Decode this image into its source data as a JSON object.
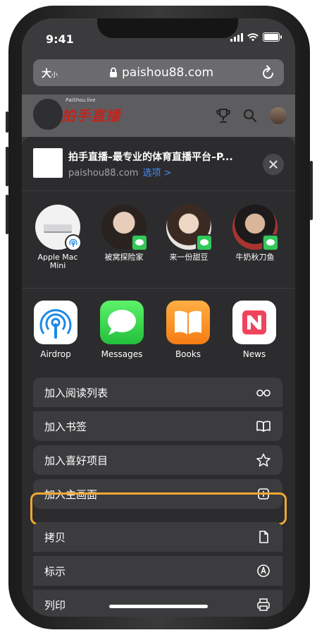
{
  "status_bar": {
    "time": "9:41"
  },
  "browser": {
    "text_size_label": "大",
    "text_size_small": "小",
    "domain": "paishou88.com"
  },
  "webpage": {
    "logo_small": "PaiShou.live",
    "logo_text": "拍手直播"
  },
  "share_sheet": {
    "title": "拍手直播–最专业的体育直播平台–P...",
    "subtitle": "paishou88.com",
    "options_link": "选项 >",
    "people": [
      {
        "name": "Apple Mac\nMini",
        "type": "device",
        "badge": "airdrop-icon"
      },
      {
        "name": "被窝探险家",
        "type": "contact",
        "badge": "messages-icon"
      },
      {
        "name": "来一份甜豆",
        "type": "contact",
        "badge": "messages-icon"
      },
      {
        "name": "牛奶秋刀鱼",
        "type": "contact",
        "badge": "messages-icon"
      }
    ],
    "apps": [
      {
        "label": "Airdrop",
        "icon": "airdrop-icon"
      },
      {
        "label": "Messages",
        "icon": "messages-icon"
      },
      {
        "label": "Books",
        "icon": "books-icon"
      },
      {
        "label": "News",
        "icon": "news-icon"
      }
    ],
    "actions": [
      {
        "label": "加入阅读列表",
        "icon": "glasses-icon"
      },
      {
        "label": "加入书签",
        "icon": "book-open-icon"
      },
      {
        "label": "加入喜好项目",
        "icon": "star-icon"
      },
      {
        "label": "加入主画面",
        "icon": "plus-square-icon",
        "highlighted": true
      },
      {
        "label": "拷贝",
        "icon": "document-icon"
      },
      {
        "label": "标示",
        "icon": "markup-icon"
      },
      {
        "label": "列印",
        "icon": "printer-icon"
      }
    ]
  },
  "colors": {
    "highlight": "#f0a92e",
    "messages_green": "#34c759",
    "link_blue": "#4a8bf5",
    "books_orange": "#f6902b",
    "news_red": "#f0435c"
  }
}
